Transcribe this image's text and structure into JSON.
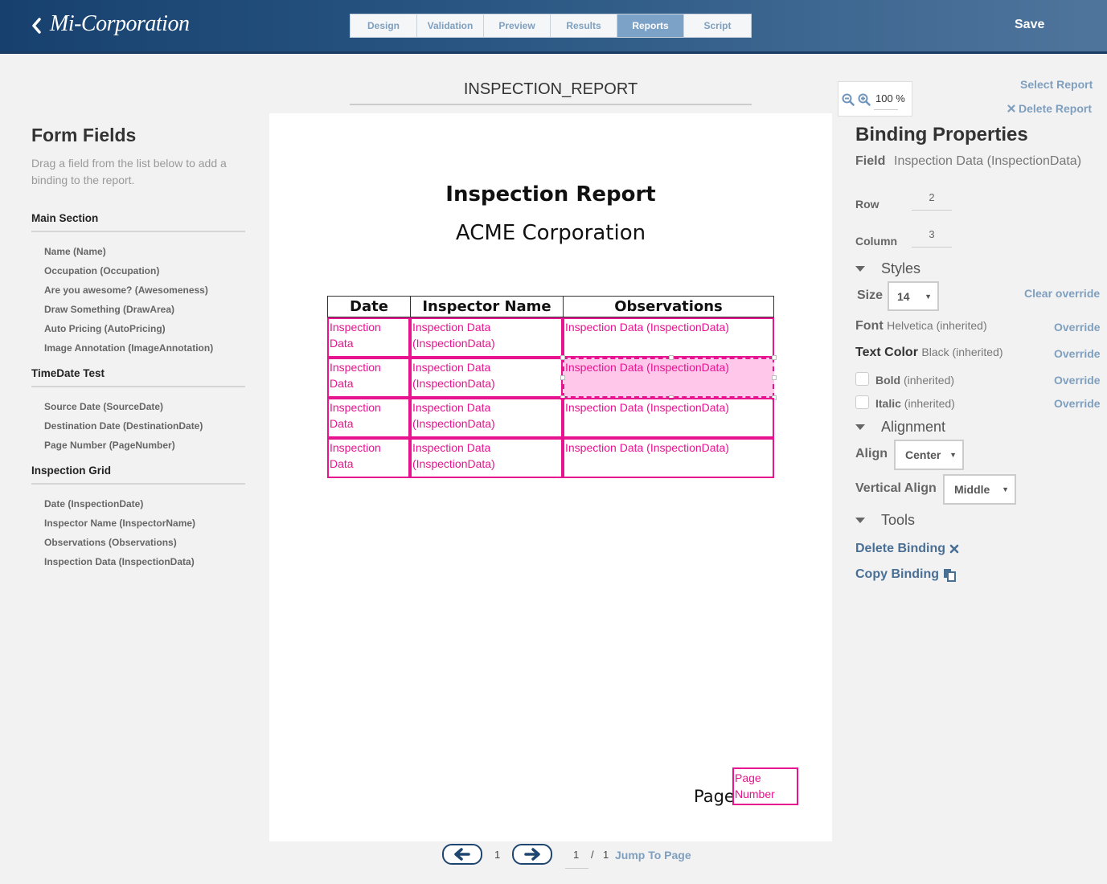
{
  "header": {
    "logo": "Mi-Corporation",
    "tabs": [
      {
        "label": "Design"
      },
      {
        "label": "Validation"
      },
      {
        "label": "Preview"
      },
      {
        "label": "Results"
      },
      {
        "label": "Reports",
        "active": true
      },
      {
        "label": "Script"
      }
    ],
    "save_label": "Save",
    "back_icon": "chevron-left-icon"
  },
  "left_panel": {
    "title": "Form Fields",
    "hint": "Drag a field from the list below to add a binding to the report.",
    "sections": [
      {
        "title": "Main Section",
        "items": [
          "Name (Name)",
          "Occupation (Occupation)",
          "Are you awesome? (Awesomeness)",
          "Draw Something (DrawArea)",
          "Auto Pricing (AutoPricing)",
          "Image Annotation (ImageAnnotation)"
        ]
      },
      {
        "title": "TimeDate Test",
        "items": [
          "Source Date (SourceDate)",
          "Destination Date (DestinationDate)",
          "Page Number (PageNumber)"
        ]
      },
      {
        "title": "Inspection Grid",
        "items": [
          "Date (InspectionDate)",
          "Inspector Name (InspectorName)",
          "Observations (Observations)",
          "Inspection Data (InspectionData)"
        ]
      }
    ]
  },
  "canvas": {
    "report_name": "INSPECTION_REPORT",
    "doc_title": "Inspection Report",
    "doc_subtitle": "ACME Corporation",
    "grid_headers": [
      "Date",
      "Inspector Name",
      "Observations"
    ],
    "rows": [
      [
        "Inspection Data",
        "Inspection Data (InspectionData)",
        "Inspection Data (InspectionData)"
      ],
      [
        "Inspection Data",
        "Inspection Data (InspectionData)",
        "Inspection Data (InspectionData)"
      ],
      [
        "Inspection Data",
        "Inspection Data (InspectionData)",
        "Inspection Data (InspectionData)"
      ],
      [
        "Inspection Data",
        "Inspection Data (InspectionData)",
        "Inspection Data (InspectionData)"
      ]
    ],
    "page_label": "Page",
    "page_number_binding": "Page Number",
    "accent_color": "#e8138f"
  },
  "pager": {
    "prev_icon": "arrow-left-icon",
    "next_icon": "arrow-right-icon",
    "current": "1",
    "page_input": "1",
    "separator": "/",
    "total": "1",
    "jump_label": "Jump To Page"
  },
  "zoom": {
    "zoom_out_icon": "zoom-out-icon",
    "zoom_in_icon": "zoom-in-icon",
    "value": "100 %"
  },
  "right_panel": {
    "select_report": "Select Report",
    "delete_report": "Delete Report",
    "title": "Binding Properties",
    "field_label": "Field",
    "field_value": "Inspection Data (InspectionData)",
    "row_label": "Row",
    "row_value": "2",
    "column_label": "Column",
    "column_value": "3",
    "styles_title": "Styles",
    "size_label": "Size",
    "size_value": "14",
    "clear_override": "Clear override",
    "font_label": "Font",
    "font_value": "Helvetica (inherited)",
    "text_color_label": "Text Color",
    "text_color_value": "Black (inherited)",
    "bold_label": "Bold",
    "bold_value": "(inherited)",
    "italic_label": "Italic",
    "italic_value": "(inherited)",
    "override_label": "Override",
    "alignment_title": "Alignment",
    "align_label": "Align",
    "align_value": "Center",
    "valign_label": "Vertical Align",
    "valign_value": "Middle",
    "tools_title": "Tools",
    "delete_binding": "Delete Binding",
    "copy_binding": "Copy Binding"
  }
}
